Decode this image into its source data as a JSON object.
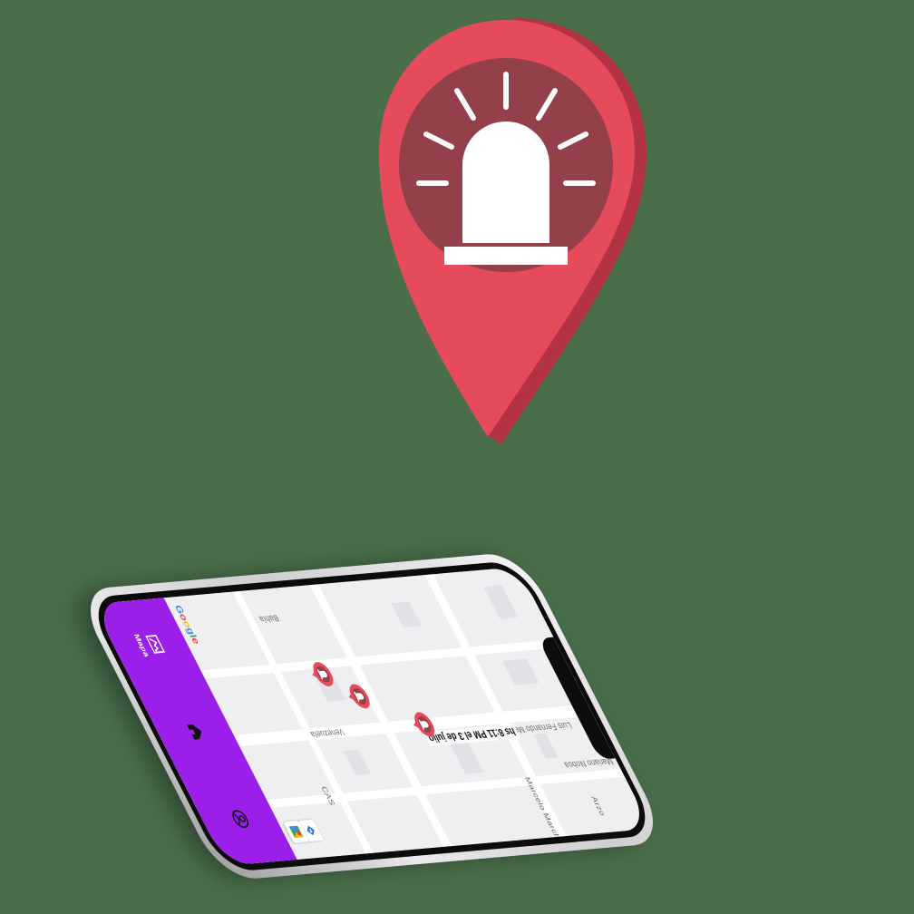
{
  "map": {
    "streets": {
      "s1": "Mariano Noboa",
      "s2": "Luis Fernando Melio",
      "s3": "Marcelo Marchena",
      "s4": "Venezuela",
      "s5": "Bahía",
      "s6": "CAS",
      "s7": "Arzo"
    },
    "alert_label": "hs 8:11 PM el 3 de julio"
  },
  "google": {
    "g": "G",
    "o1": "o",
    "o2": "o",
    "g2": "g",
    "l": "l",
    "e": "e"
  },
  "nav": {
    "items": [
      {
        "label": "Mapa",
        "icon": "map-icon"
      },
      {
        "label": "",
        "icon": "home-icon"
      },
      {
        "label": "",
        "icon": "profile-icon"
      }
    ]
  },
  "colors": {
    "accent": "#9b1fe8",
    "pin_red": "#e54b5b",
    "pin_dark": "#93404b"
  }
}
